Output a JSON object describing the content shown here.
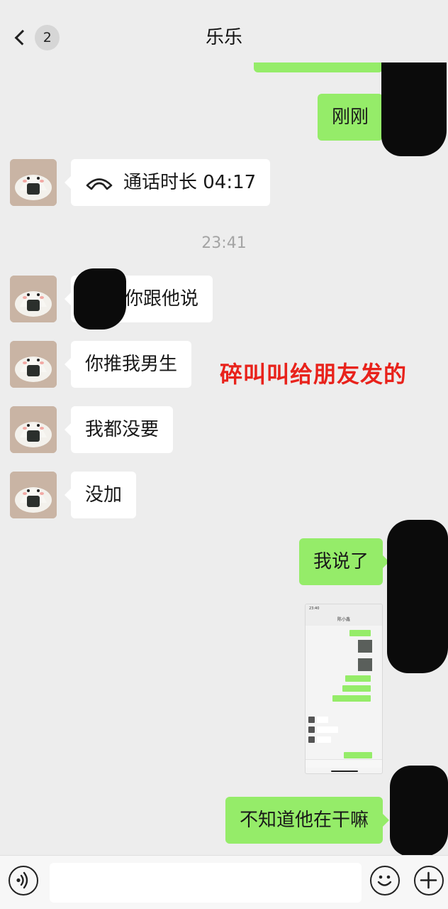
{
  "header": {
    "title": "乐乐",
    "unread_count": "2"
  },
  "messages": {
    "sent_1": "刚刚",
    "call_text": "通话时长 04:17",
    "timestamp": "23:41",
    "recv_1": "你跟他说",
    "recv_2": "你推我男生",
    "recv_3": "我都没要",
    "recv_4": "没加",
    "sent_2": "我说了",
    "sent_3": "不知道他在干嘛"
  },
  "overlay_caption": "碎叫叫给朋友发的",
  "embedded_screenshot": {
    "time": "23:40",
    "title": "陈小鑫"
  },
  "colors": {
    "background": "#ededed",
    "sent_bubble": "#95ec69",
    "received_bubble": "#ffffff",
    "caption_red": "#e8221b",
    "timestamp_gray": "#a4a4a4"
  },
  "icons": {
    "back": "chevron-left-icon",
    "call": "phone-hangup-icon",
    "voice": "voice-icon",
    "emoji": "emoji-icon",
    "more": "plus-icon"
  }
}
